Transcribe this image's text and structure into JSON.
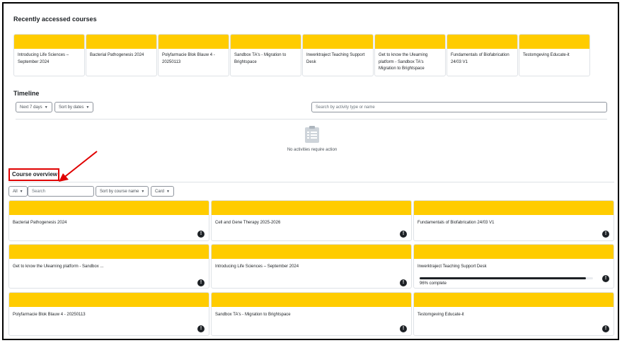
{
  "recent": {
    "heading": "Recently accessed courses",
    "courses": [
      "Introducing Life Sciences – September 2024",
      "Bacterial Pathogenesis 2024",
      "Polyfarmacie Blok Blauw 4 - 20250113",
      "Sandbox TA's - Migration to Brightspace",
      "Inwerktraject Teaching Support Desk",
      "Get to know the Ulearning platform - Sandbox TA's Migration to Brightspace",
      "Fundamentals of Biofabrication 24/03 V1",
      "Testomgeving Educate-it"
    ],
    "band_color": "#ffcc00"
  },
  "timeline": {
    "heading": "Timeline",
    "filter_label": "Next 7 days",
    "sort_label": "Sort by dates",
    "search_placeholder": "Search by activity type or name",
    "empty_text": "No activities require action",
    "empty_icon": "clipboard-list-icon"
  },
  "overview": {
    "heading": "Course overview",
    "filter_label": "All",
    "search_placeholder": "Search",
    "sort_label": "Sort by course name",
    "view_label": "Card",
    "courses": [
      {
        "title": "Bacterial Pathogenesis 2024"
      },
      {
        "title": "Cell and Gene Therapy 2025-2026"
      },
      {
        "title": "Fundamentals of Biofabrication 24/03 V1"
      },
      {
        "title": "Get to know the Ulearning platform - Sandbox ..."
      },
      {
        "title": "Introducing Life Sciences – September 2024"
      },
      {
        "title": "Inwerktraject Teaching Support Desk",
        "progress": 96,
        "progress_label": "96% complete"
      },
      {
        "title": "Polyfarmacie Blok Blauw 4 - 20250113"
      },
      {
        "title": "Sandbox TA's - Migration to Brightspace"
      },
      {
        "title": "Testomgeving Educate-it"
      }
    ]
  },
  "annotation": {
    "highlight_color": "#e00000"
  }
}
